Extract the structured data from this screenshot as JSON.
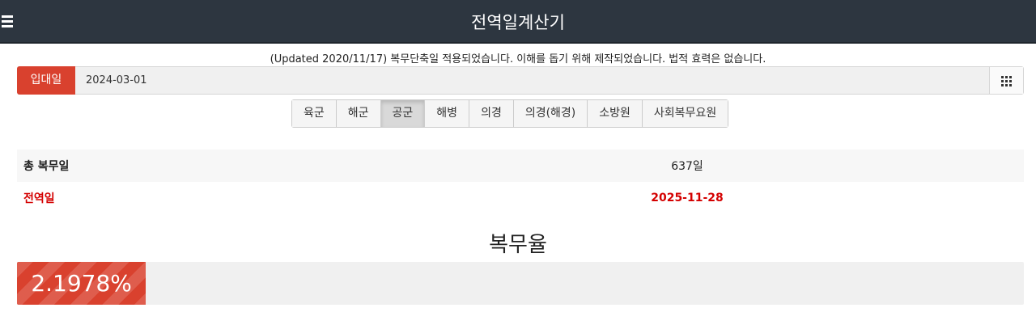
{
  "app": {
    "title": "전역일계산기"
  },
  "notice": "(Updated 2020/11/17) 복무단축일 적용되었습니다. 이해를 돕기 위해 제작되었습니다. 법적 효력은 없습니다.",
  "enlistment": {
    "label": "입대일",
    "value": "2024-03-01"
  },
  "branches": [
    {
      "label": "육군",
      "active": false
    },
    {
      "label": "해군",
      "active": false
    },
    {
      "label": "공군",
      "active": true
    },
    {
      "label": "해병",
      "active": false
    },
    {
      "label": "의경",
      "active": false
    },
    {
      "label": "의경(해경)",
      "active": false
    },
    {
      "label": "소방원",
      "active": false
    },
    {
      "label": "사회복무요원",
      "active": false
    }
  ],
  "results": {
    "total_label": "총 복무일",
    "total_value": "637일",
    "discharge_label": "전역일",
    "discharge_value": "2025-11-28"
  },
  "rate": {
    "title": "복무율",
    "value": 2.1978,
    "text": "2.1978%",
    "bar_color": "#d9412e"
  }
}
